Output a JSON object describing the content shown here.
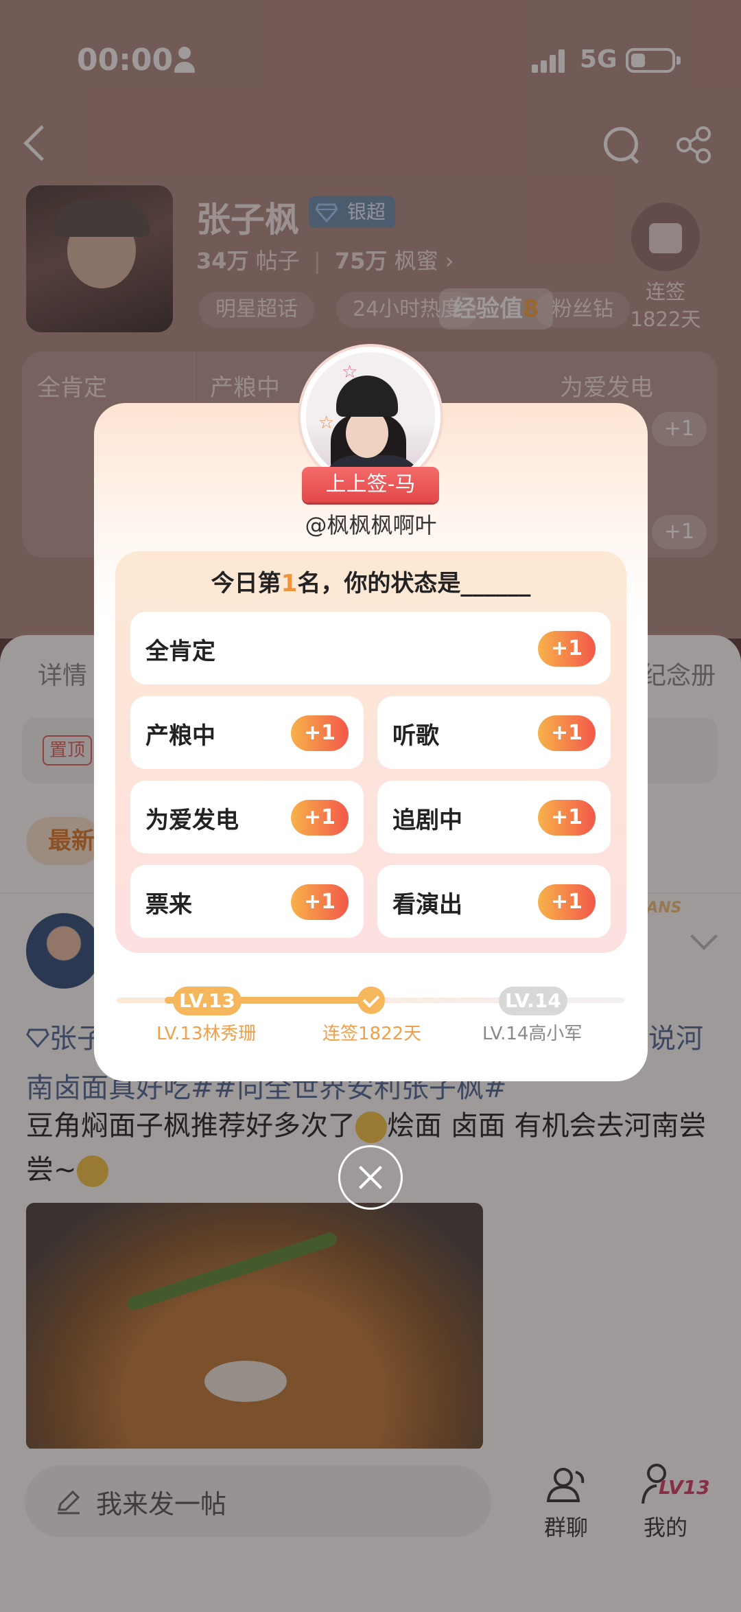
{
  "status_bar": {
    "time": "00:00",
    "network": "5G"
  },
  "profile": {
    "name": "张子枫",
    "badge": "银超",
    "posts_count": "34万",
    "posts_label": "帖子",
    "fans_count": "75万",
    "fans_label": "枫蜜 ›",
    "tags": [
      "明星超话",
      "24小时热度",
      "粉丝钻"
    ],
    "checkin_label": "连签",
    "checkin_days": "1822天",
    "exp_label": "经验值",
    "exp_value": "8"
  },
  "status_panel": {
    "columns": [
      "全肯定",
      "产粮中",
      "为爱发电"
    ],
    "plus": "+1"
  },
  "feed": {
    "tab_left": "详情",
    "tab_right": "纪念册",
    "pin_tag": "置顶",
    "newest_chip": "最新",
    "fans_badge": "FANS",
    "post_line1": "张子",
    "post_line1_right": "说河",
    "post_line2": "南卤面真好吃##向全世界安利张子枫#",
    "post_body_a": "豆角焖面子枫推荐好多次了",
    "post_body_b": "烩面 卤面 有机会去河南尝尝~"
  },
  "bottom_bar": {
    "compose_placeholder": "我来发一帖",
    "group_chat": "群聊",
    "me": "我的",
    "me_level": "LV13"
  },
  "modal": {
    "ribbon": "上上签-马",
    "username": "@枫枫枫啊叶",
    "question_prefix": "今日第",
    "question_rank": "1",
    "question_suffix": "名，你的状态是______",
    "options": [
      {
        "label": "全肯定",
        "plus": "+1"
      },
      {
        "label": "产粮中",
        "plus": "+1"
      },
      {
        "label": "听歌",
        "plus": "+1"
      },
      {
        "label": "为爱发电",
        "plus": "+1"
      },
      {
        "label": "追剧中",
        "plus": "+1"
      },
      {
        "label": "票来",
        "plus": "+1"
      },
      {
        "label": "看演出",
        "plus": "+1"
      }
    ],
    "level": {
      "current_pill": "LV.13",
      "next_pill": "LV.14",
      "current_caption": "LV.13林秀珊",
      "mid_caption": "连签1822天",
      "next_caption": "LV.14高小军"
    }
  },
  "colors": {
    "accent_orange": "#f0933a",
    "plus_gradient_start": "#f7b24a",
    "plus_gradient_end": "#f2584a",
    "ribbon_red": "#e24848",
    "link_blue": "#4d6b9a",
    "level_pink": "#d63a6a"
  }
}
